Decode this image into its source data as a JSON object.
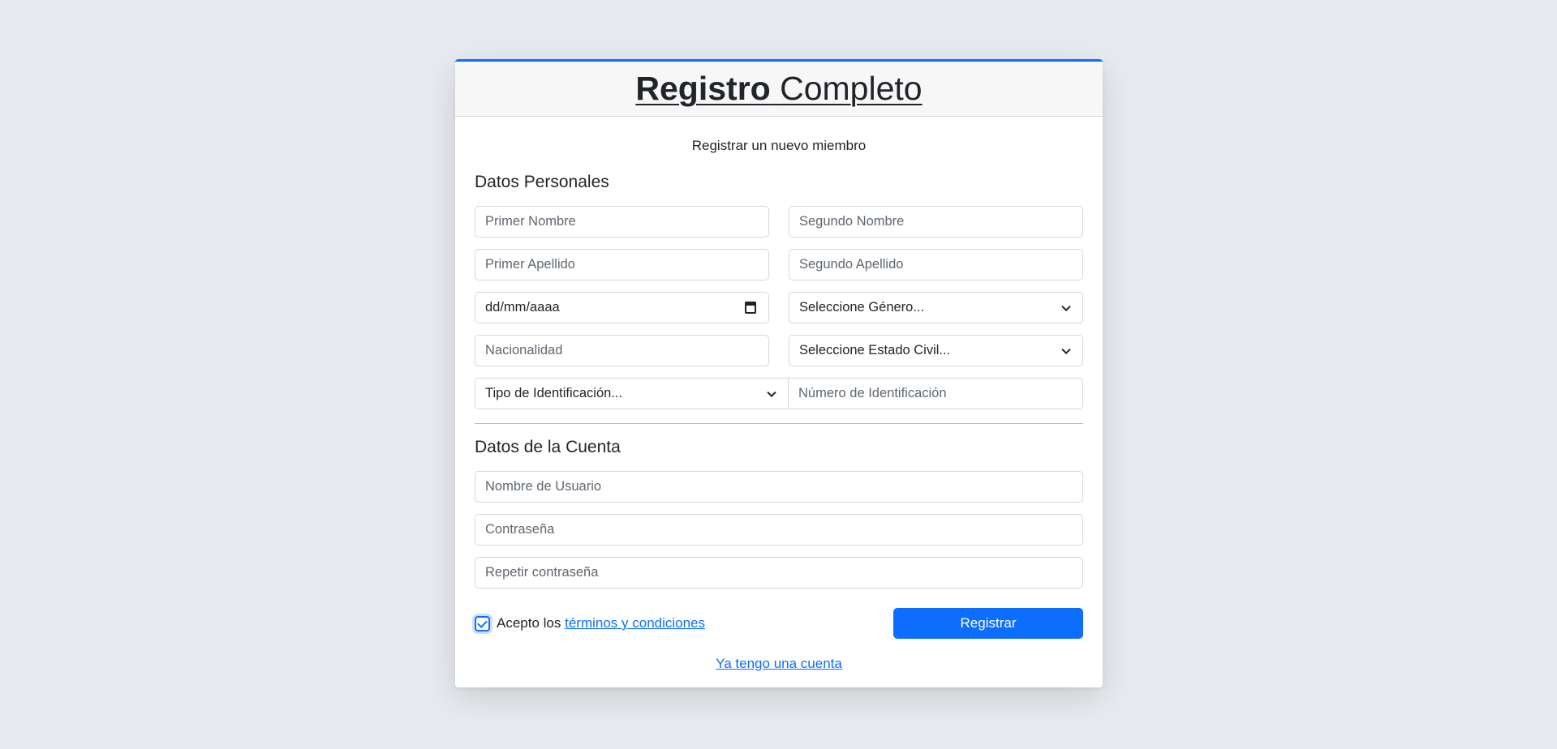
{
  "header": {
    "title_bold": "Registro",
    "title_rest": "Completo"
  },
  "subtitle": "Registrar un nuevo miembro",
  "personal": {
    "title": "Datos Personales",
    "first_name_placeholder": "Primer Nombre",
    "second_name_placeholder": "Segundo Nombre",
    "first_lastname_placeholder": "Primer Apellido",
    "second_lastname_placeholder": "Segundo Apellido",
    "birthdate_value": "dd/mm/aaaa",
    "gender_select": "Seleccione Género...",
    "nationality_placeholder": "Nacionalidad",
    "civil_status_select": "Seleccione Estado Civil...",
    "id_type_select": "Tipo de Identificación...",
    "id_number_placeholder": "Número de Identificación"
  },
  "account": {
    "title": "Datos de la Cuenta",
    "username_placeholder": "Nombre de Usuario",
    "password_placeholder": "Contraseña",
    "repeat_password_placeholder": "Repetir contraseña"
  },
  "terms": {
    "prefix": "Acepto los",
    "link": "términos y condiciones",
    "checked": true
  },
  "submit_label": "Registrar",
  "login_link": "Ya tengo una cuenta",
  "colors": {
    "accent": "#0d6efd",
    "background": "#e7eaee"
  }
}
